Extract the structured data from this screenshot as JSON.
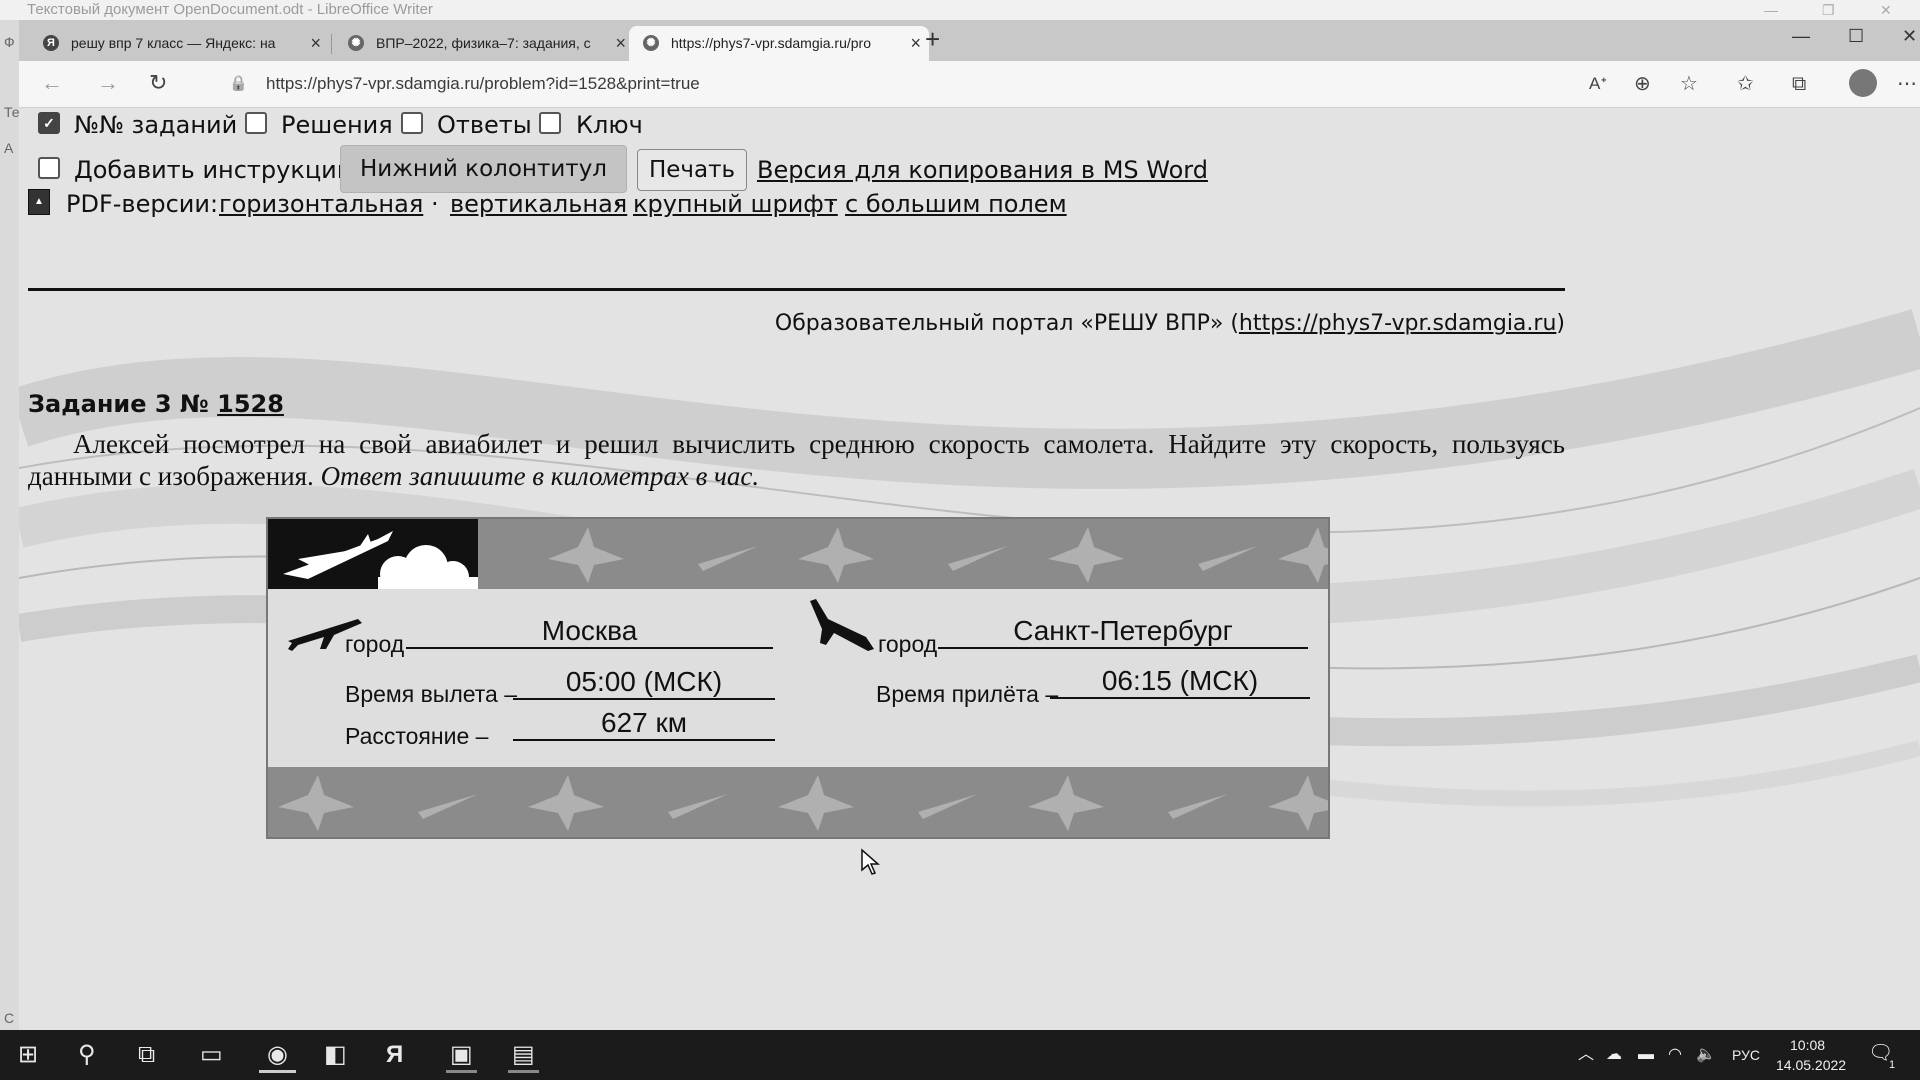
{
  "libreoffice": {
    "title": "Текстовый документ OpenDocument.odt - LibreOffice Writer",
    "side_letters": [
      "Ф",
      "Те",
      "A",
      "C"
    ]
  },
  "browser": {
    "tabs": [
      {
        "label": "решу впр 7 класс — Яндекс: на",
        "icon": "yandex-icon",
        "favicon_text": "Я"
      },
      {
        "label": "ВПР–2022, физика–7: задания, с",
        "icon": "sdamgia-icon",
        "favicon_text": "✺"
      },
      {
        "label": "https://phys7-vpr.sdamgia.ru/pro",
        "icon": "sdamgia-icon",
        "favicon_text": "✺",
        "active": true
      }
    ],
    "url": "https://phys7-vpr.sdamgia.ru/problem?id=1528&print=true"
  },
  "options": {
    "task_numbers": {
      "label": "№№ заданий",
      "checked": true
    },
    "solutions": {
      "label": "Решения",
      "checked": false
    },
    "answers": {
      "label": "Ответы",
      "checked": false
    },
    "key": {
      "label": "Ключ",
      "checked": false
    },
    "add_instruction": {
      "label": "Добавить инструкцию",
      "checked": false
    },
    "footer_button": "Нижний колонтитул",
    "print_button": "Печать",
    "word_link": "Версия для копирования в MS Word"
  },
  "pdf": {
    "label": "PDF-версии:",
    "links": [
      "горизонтальная",
      "вертикальная",
      "крупный шрифт",
      "с большим полем"
    ],
    "separator": "·"
  },
  "portal": {
    "prefix": "Образовательный портал «РЕШУ ВПР» (",
    "link": "https://phys7-vpr.sdamgia.ru",
    "suffix": ")"
  },
  "task": {
    "heading_prefix": "Задание 3 №",
    "number": "1528",
    "text": "Алексей посмотрел на свой авиабилет и решил вычислить среднюю скорость самолета. Найдите эту скорость, пользуясь данными с изображения.",
    "text_italic": "Ответ запишите в километрах в час."
  },
  "ticket": {
    "city_label": "город",
    "departure_city": "Москва",
    "arrival_city": "Санкт-Петербург",
    "departure_time_label": "Время вылета –",
    "departure_time": "05:00 (МСК)",
    "arrival_time_label": "Время прилёта –",
    "arrival_time": "06:15 (МСК)",
    "distance_label": "Расстояние –",
    "distance": "627 км"
  },
  "taskbar": {
    "language": "РУС",
    "time": "10:08",
    "date": "14.05.2022",
    "notification_count": "1"
  }
}
